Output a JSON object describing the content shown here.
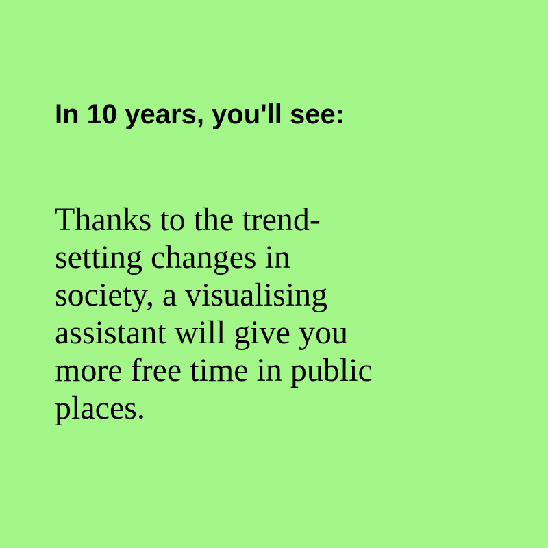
{
  "headline": "In 10 years, you'll see:",
  "body_lines": [
    "Thanks to the trend-",
    "setting changes in",
    "society, a visualising",
    "assistant will give you",
    "more free time in public",
    "places."
  ],
  "colors": {
    "background": "#a3f788",
    "text": "#000000"
  }
}
